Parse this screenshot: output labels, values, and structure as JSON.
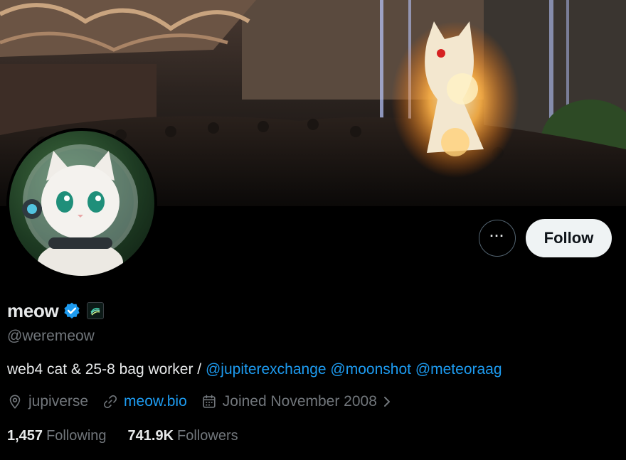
{
  "profile": {
    "display_name": "meow",
    "handle": "@weremeow",
    "bio_text": "web4 cat & 25-8 bag worker / ",
    "bio_mentions": [
      "@jupiterexchange",
      "@moonshot",
      "@meteoraag"
    ],
    "location": "jupiverse",
    "website": "meow.bio",
    "joined": "Joined November 2008",
    "following_count": "1,457",
    "following_label": "Following",
    "followers_count": "741.9K",
    "followers_label": "Followers",
    "verified": true
  },
  "actions": {
    "more_label": "···",
    "follow_label": "Follow"
  },
  "icons": {
    "verified": "verified-badge-icon",
    "affiliate": "affiliate-badge-icon",
    "location": "location-pin-icon",
    "link": "link-icon",
    "calendar": "calendar-icon",
    "chevron": "chevron-right-icon"
  },
  "colors": {
    "background": "#000000",
    "accent": "#1d9bf0",
    "secondary_text": "#71767b",
    "follow_button_bg": "#eff3f4"
  }
}
